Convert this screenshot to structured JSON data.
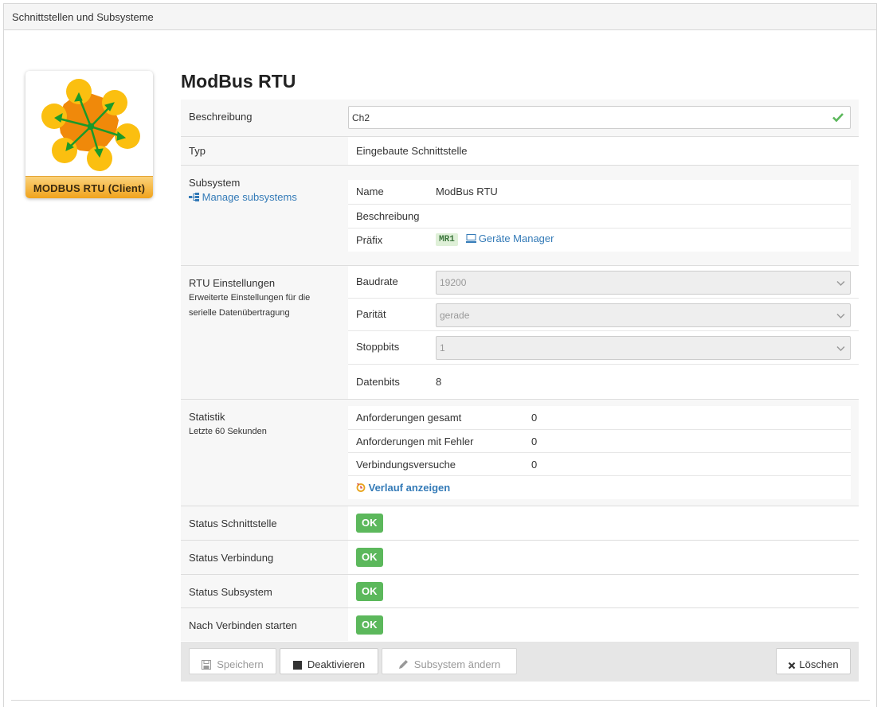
{
  "panel": {
    "title": "Schnittstellen und Subsysteme"
  },
  "logo": {
    "caption": "MODBUS RTU (Client)"
  },
  "main": {
    "title": "ModBus RTU"
  },
  "colors": {
    "ok": "#5cb85c",
    "link": "#337ab7",
    "logo_orange": "#f0a31c",
    "arrow_green": "#1a9a2a"
  },
  "rows": {
    "beschreibung": {
      "label": "Beschreibung",
      "value": "Ch2",
      "icon": "check-icon"
    },
    "typ": {
      "label": "Typ",
      "value": "Eingebaute Schnittstelle"
    },
    "subsystem": {
      "label": "Subsystem",
      "manage_link": "Manage subsystems",
      "manage_icon": "sitemap-icon",
      "name_label": "Name",
      "name_value": "ModBus RTU",
      "desc_label": "Beschreibung",
      "desc_value": "",
      "prefix_label": "Präfix",
      "prefix_value": "MR1",
      "device_manager_link": "Geräte Manager",
      "device_manager_icon": "monitor-icon"
    },
    "rtu": {
      "label": "RTU Einstellungen",
      "sub1": "Erweiterte Einstellungen für die",
      "sub2": "serielle Datenübertragung",
      "baud_label": "Baudrate",
      "baud_value": "19200",
      "parity_label": "Parität",
      "parity_value": "gerade",
      "stop_label": "Stoppbits",
      "stop_value": "1",
      "data_label": "Datenbits",
      "data_value": "8"
    },
    "statistik": {
      "label": "Statistik",
      "sub": "Letzte 60 Sekunden",
      "items": [
        {
          "label": "Anforderungen gesamt",
          "value": "0"
        },
        {
          "label": "Anforderungen mit Fehler",
          "value": "0"
        },
        {
          "label": "Verbindungsversuche",
          "value": "0"
        }
      ],
      "history_link": "Verlauf anzeigen",
      "history_icon": "history-icon"
    },
    "status_schnittstelle": {
      "label": "Status Schnittstelle",
      "value": "OK"
    },
    "status_verbindung": {
      "label": "Status Verbindung",
      "value": "OK"
    },
    "status_subsystem": {
      "label": "Status Subsystem",
      "value": "OK"
    },
    "nach_verbinden": {
      "label": "Nach Verbinden starten",
      "value": "OK"
    }
  },
  "toolbar": {
    "save_label": "Speichern",
    "deactivate_label": "Deaktivieren",
    "change_subsystem_label": "Subsystem ändern",
    "delete_label": "Löschen"
  }
}
